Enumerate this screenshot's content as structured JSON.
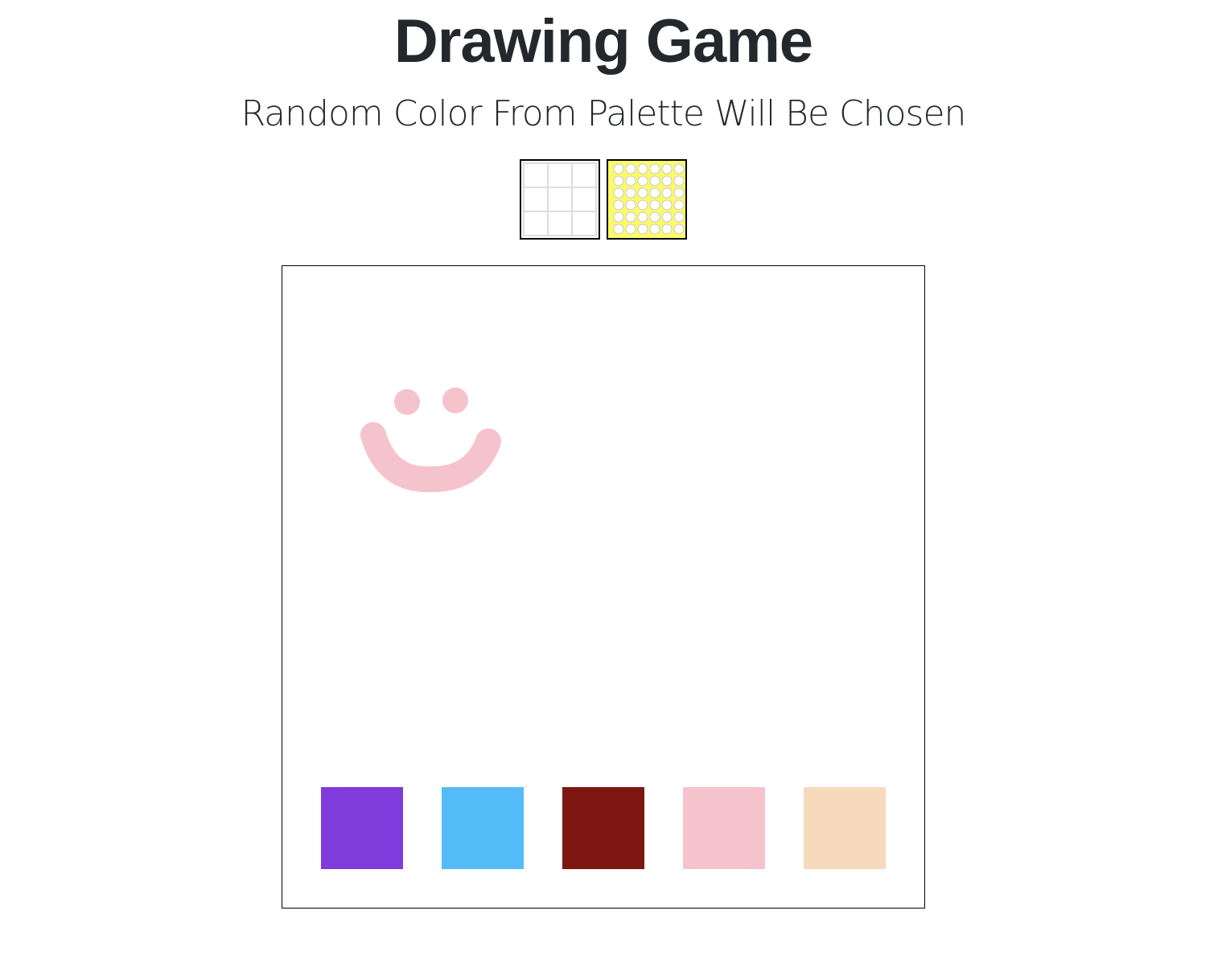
{
  "header": {
    "title": "Drawing Game",
    "subtitle": "Random Color From Palette Will Be Chosen"
  },
  "modes": [
    {
      "id": "grid",
      "icon": "grid-pattern-icon",
      "background": "#ffffff"
    },
    {
      "id": "dots",
      "icon": "dot-pattern-icon",
      "background": "#fbfb6a"
    }
  ],
  "palette": [
    {
      "name": "purple",
      "color": "#7f3bdb"
    },
    {
      "name": "light-blue",
      "color": "#53bcf7"
    },
    {
      "name": "dark-red",
      "color": "#7e1711"
    },
    {
      "name": "pink",
      "color": "#f5c3cc"
    },
    {
      "name": "peach",
      "color": "#f7dabc"
    }
  ],
  "drawing": {
    "stroke_color": "#f5c3cc",
    "shape": "smiley-face"
  }
}
